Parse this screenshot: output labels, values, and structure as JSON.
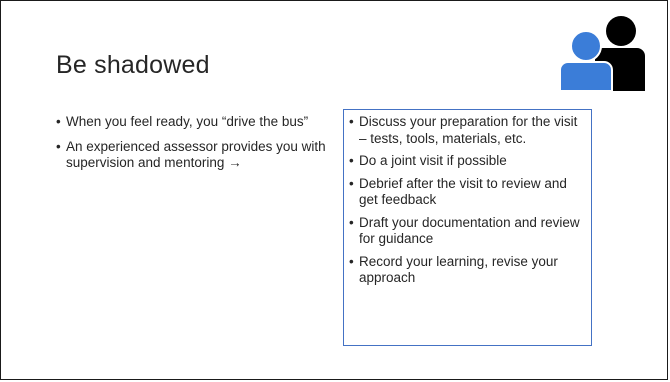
{
  "slide": {
    "title": "Be shadowed",
    "icon": "two-people-icon",
    "colors": {
      "person_front": "#3b7dd8",
      "person_back": "#000000",
      "box_border": "#4472c4",
      "text": "#262626"
    },
    "left_bullets": [
      "When you feel ready, you “drive the bus”",
      "An experienced assessor provides you with supervision and mentoring →"
    ],
    "right_bullets": [
      "Discuss your preparation for the visit – tests, tools, materials, etc.",
      "Do a joint visit if possible",
      "Debrief after the visit to review and get feedback",
      "Draft your documentation and review for guidance",
      "Record your learning, revise your approach"
    ]
  }
}
